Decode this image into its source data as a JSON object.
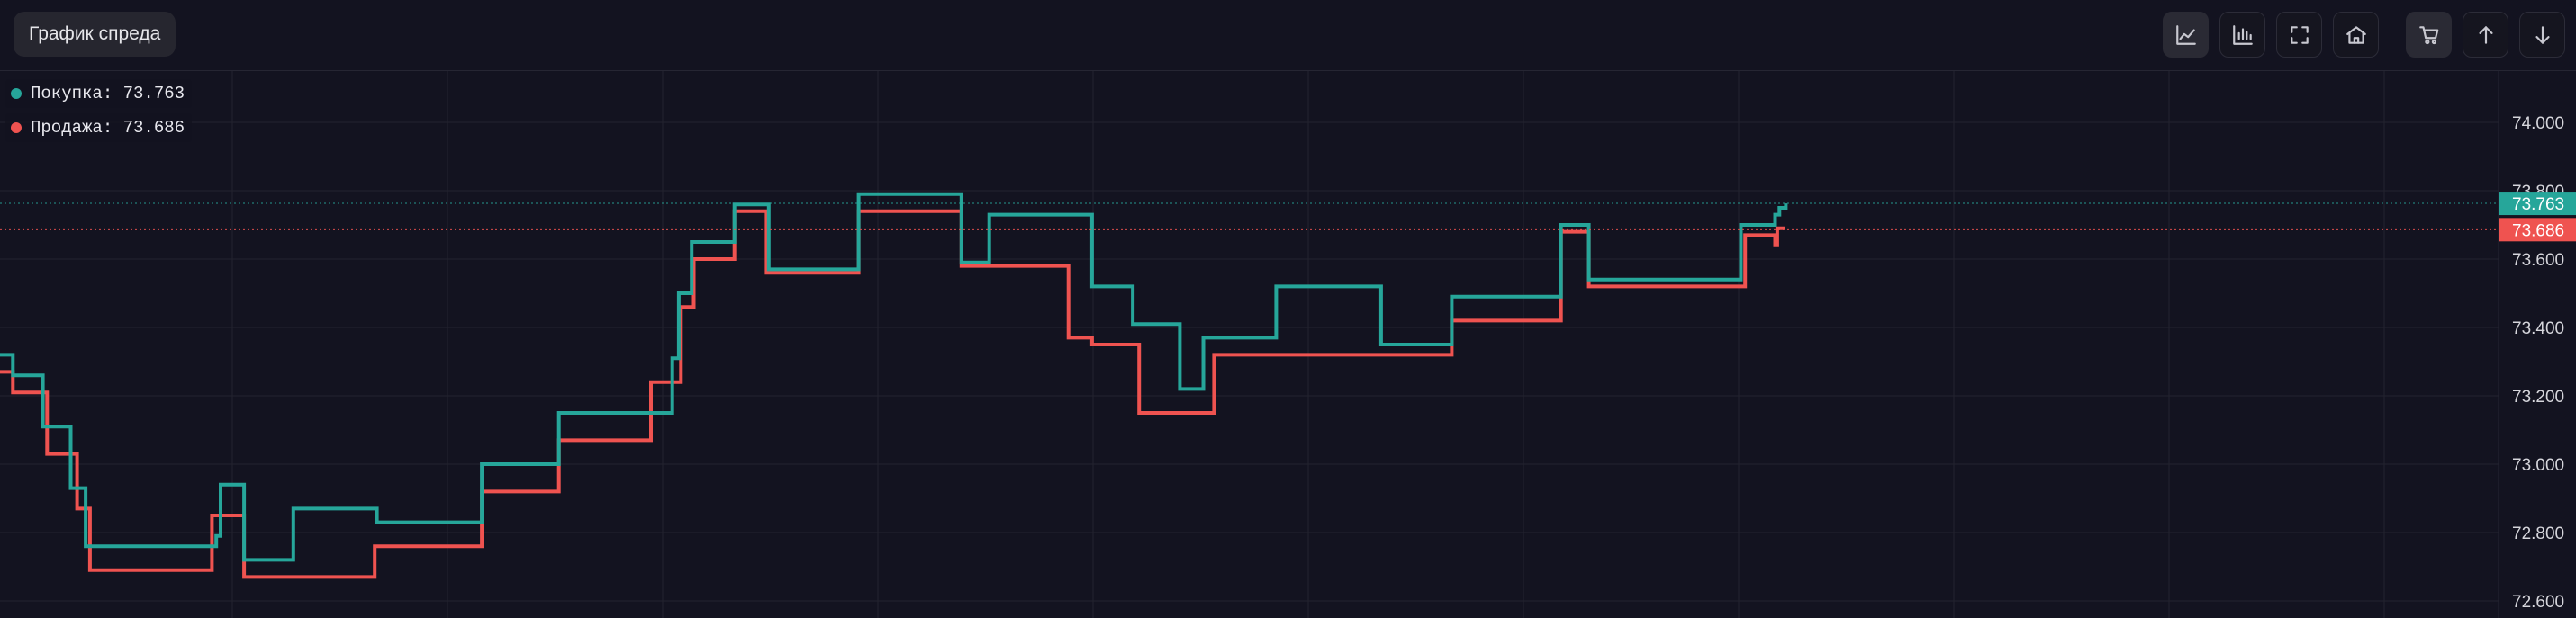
{
  "header": {
    "title": "График спреда"
  },
  "toolbar": {
    "buttons": [
      {
        "name": "chart-line-button",
        "icon": "chart-line-icon",
        "active": true
      },
      {
        "name": "chart-bars-button",
        "icon": "chart-bars-icon",
        "active": false
      },
      {
        "name": "fullscreen-button",
        "icon": "fullscreen-icon",
        "active": false
      },
      {
        "name": "home-button",
        "icon": "home-icon",
        "active": false
      },
      {
        "name": "cart-button",
        "icon": "cart-icon",
        "active": true
      },
      {
        "name": "arrow-up-button",
        "icon": "arrow-up-icon",
        "active": false
      },
      {
        "name": "arrow-down-button",
        "icon": "arrow-down-icon",
        "active": false
      }
    ]
  },
  "legend": {
    "buy": {
      "text": "Покупка: 73.763",
      "color": "#26a69a"
    },
    "sell": {
      "text": "Продажа: 73.686",
      "color": "#ef5350"
    }
  },
  "colors": {
    "background": "#131320",
    "grid": "#23232f",
    "axis_text": "#d6d6dc",
    "buy": "#26a69a",
    "sell": "#ef5350"
  },
  "chart_data": {
    "type": "line",
    "ylim": [
      72.55,
      74.15
    ],
    "xlim": [
      0,
      1000
    ],
    "y_ticks": [
      "74.000",
      "73.800",
      "73.600",
      "73.400",
      "73.200",
      "73.000",
      "72.800",
      "72.600"
    ],
    "y_tick_values": [
      74.0,
      73.8,
      73.6,
      73.4,
      73.2,
      73.0,
      72.8,
      72.6
    ],
    "grid": true,
    "series": [
      {
        "name": "Покупка",
        "color": "#26a69a",
        "last_value": "73.763",
        "values": [
          [
            0,
            73.32
          ],
          [
            6,
            73.32
          ],
          [
            6,
            73.26
          ],
          [
            20,
            73.26
          ],
          [
            20,
            73.11
          ],
          [
            33,
            73.11
          ],
          [
            33,
            72.93
          ],
          [
            40,
            72.93
          ],
          [
            40,
            72.76
          ],
          [
            101,
            72.76
          ],
          [
            101,
            72.79
          ],
          [
            103,
            72.79
          ],
          [
            103,
            72.94
          ],
          [
            114,
            72.94
          ],
          [
            114,
            72.72
          ],
          [
            137,
            72.72
          ],
          [
            137,
            72.87
          ],
          [
            176,
            72.87
          ],
          [
            176,
            72.83
          ],
          [
            225,
            72.83
          ],
          [
            225,
            73.0
          ],
          [
            261,
            73.0
          ],
          [
            261,
            73.15
          ],
          [
            314,
            73.15
          ],
          [
            314,
            73.31
          ],
          [
            317,
            73.31
          ],
          [
            317,
            73.5
          ],
          [
            323,
            73.5
          ],
          [
            323,
            73.65
          ],
          [
            343,
            73.65
          ],
          [
            343,
            73.76
          ],
          [
            359,
            73.76
          ],
          [
            359,
            73.57
          ],
          [
            401,
            73.57
          ],
          [
            401,
            73.79
          ],
          [
            449,
            73.79
          ],
          [
            449,
            73.59
          ],
          [
            462,
            73.59
          ],
          [
            462,
            73.73
          ],
          [
            510,
            73.73
          ],
          [
            510,
            73.52
          ],
          [
            529,
            73.52
          ],
          [
            529,
            73.41
          ],
          [
            551,
            73.41
          ],
          [
            551,
            73.22
          ],
          [
            562,
            73.22
          ],
          [
            562,
            73.37
          ],
          [
            596,
            73.37
          ],
          [
            596,
            73.52
          ],
          [
            645,
            73.52
          ],
          [
            645,
            73.35
          ],
          [
            678,
            73.35
          ],
          [
            678,
            73.49
          ],
          [
            729,
            73.49
          ],
          [
            729,
            73.7
          ],
          [
            742,
            73.7
          ],
          [
            742,
            73.54
          ],
          [
            813,
            73.54
          ],
          [
            813,
            73.7
          ],
          [
            829,
            73.7
          ],
          [
            829,
            73.73
          ],
          [
            831,
            73.73
          ],
          [
            831,
            73.75
          ],
          [
            834,
            73.75
          ],
          [
            834,
            73.763
          ]
        ]
      },
      {
        "name": "Продажа",
        "color": "#ef5350",
        "last_value": "73.686",
        "values": [
          [
            0,
            73.27
          ],
          [
            6,
            73.27
          ],
          [
            6,
            73.21
          ],
          [
            22,
            73.21
          ],
          [
            22,
            73.03
          ],
          [
            36,
            73.03
          ],
          [
            36,
            72.87
          ],
          [
            42,
            72.87
          ],
          [
            42,
            72.69
          ],
          [
            99,
            72.69
          ],
          [
            99,
            72.85
          ],
          [
            114,
            72.85
          ],
          [
            114,
            72.67
          ],
          [
            175,
            72.67
          ],
          [
            175,
            72.76
          ],
          [
            225,
            72.76
          ],
          [
            225,
            72.92
          ],
          [
            261,
            72.92
          ],
          [
            261,
            73.07
          ],
          [
            304,
            73.07
          ],
          [
            304,
            73.24
          ],
          [
            318,
            73.24
          ],
          [
            318,
            73.46
          ],
          [
            324,
            73.46
          ],
          [
            324,
            73.6
          ],
          [
            343,
            73.6
          ],
          [
            343,
            73.74
          ],
          [
            358,
            73.74
          ],
          [
            358,
            73.56
          ],
          [
            401,
            73.56
          ],
          [
            401,
            73.74
          ],
          [
            449,
            73.74
          ],
          [
            449,
            73.58
          ],
          [
            499,
            73.58
          ],
          [
            499,
            73.37
          ],
          [
            510,
            73.37
          ],
          [
            510,
            73.35
          ],
          [
            532,
            73.35
          ],
          [
            532,
            73.15
          ],
          [
            567,
            73.15
          ],
          [
            567,
            73.32
          ],
          [
            678,
            73.32
          ],
          [
            678,
            73.42
          ],
          [
            729,
            73.42
          ],
          [
            729,
            73.68
          ],
          [
            742,
            73.68
          ],
          [
            742,
            73.52
          ],
          [
            815,
            73.52
          ],
          [
            815,
            73.67
          ],
          [
            829,
            73.67
          ],
          [
            829,
            73.64
          ],
          [
            830,
            73.64
          ],
          [
            830,
            73.69
          ],
          [
            833,
            73.69
          ],
          [
            833,
            73.686
          ]
        ]
      }
    ]
  }
}
